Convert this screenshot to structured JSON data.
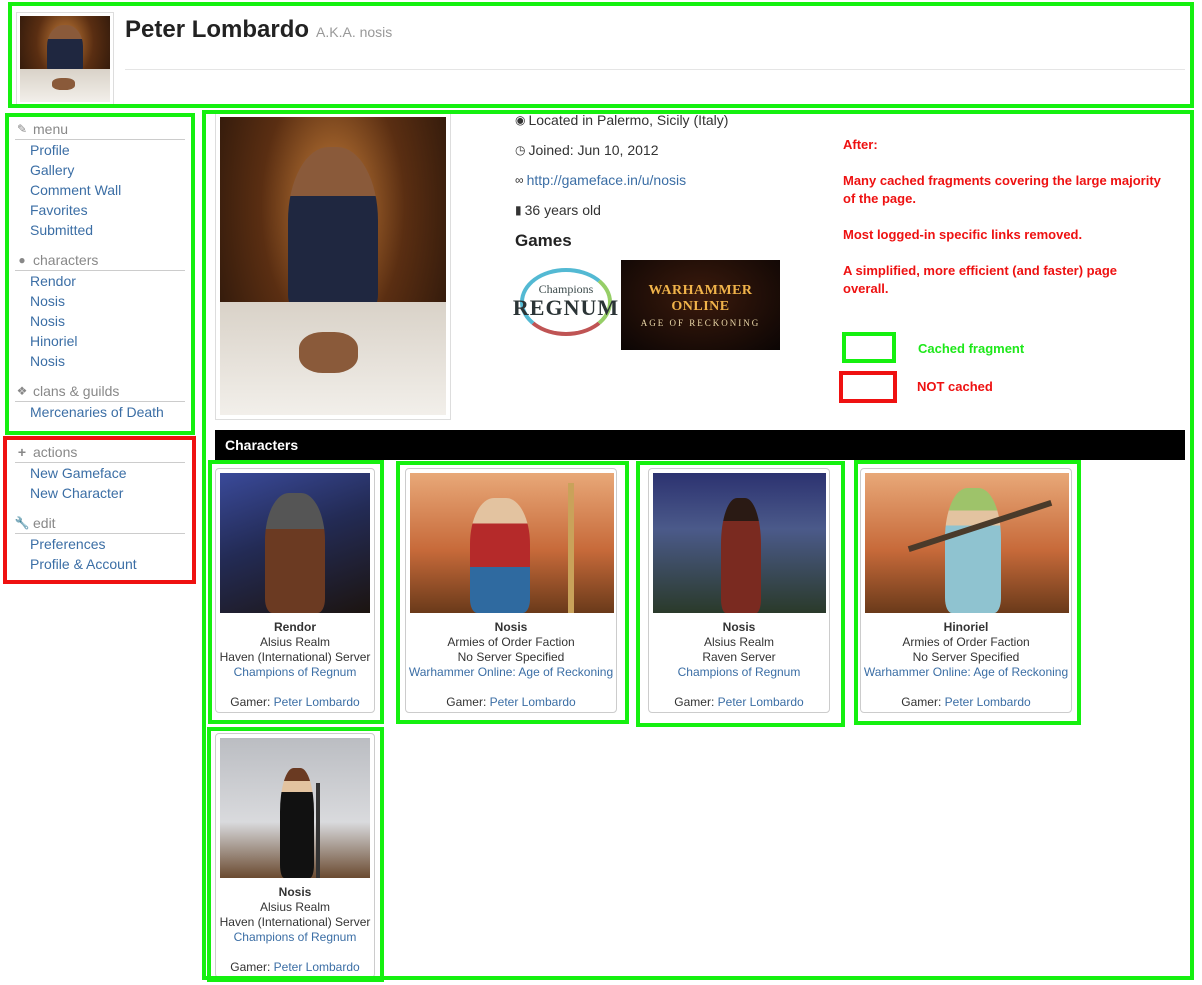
{
  "header": {
    "name": "Peter Lombardo",
    "aka": "A.K.A. nosis"
  },
  "sidebar": {
    "menu": {
      "heading": "menu",
      "items": [
        "Profile",
        "Gallery",
        "Comment Wall",
        "Favorites",
        "Submitted"
      ]
    },
    "characters": {
      "heading": "characters",
      "items": [
        "Rendor",
        "Nosis",
        "Nosis",
        "Hinoriel",
        "Nosis"
      ]
    },
    "clans": {
      "heading": "clans & guilds",
      "items": [
        "Mercenaries of Death"
      ]
    },
    "actions": {
      "heading": "actions",
      "items": [
        "New Gameface",
        "New Character"
      ]
    },
    "edit": {
      "heading": "edit",
      "items": [
        "Preferences",
        "Profile & Account"
      ]
    }
  },
  "profile": {
    "location": "Located in Palermo, Sicily (Italy)",
    "joined": "Joined: Jun 10, 2012",
    "url": "http://gameface.in/u/nosis",
    "age": "36 years old",
    "games_title": "Games",
    "games": [
      {
        "name_top": "Champions",
        "name_bottom": "REGNUM",
        "icon": "champions-of-regnum-logo"
      },
      {
        "name_top": "WARHAMMER ONLINE",
        "name_bottom": "AGE OF RECKONING",
        "icon": "warhammer-online-logo"
      }
    ]
  },
  "annotations": {
    "after": "After:",
    "line1": "Many cached fragments covering the large majority of the page.",
    "line2": "Most logged-in specific links removed.",
    "line3": "A simplified, more efficient (and faster) page overall.",
    "legend_cached": "Cached fragment",
    "legend_not_cached": "NOT cached",
    "colors": {
      "cached": "#15f00f",
      "not_cached": "#ef1111"
    }
  },
  "characters_section": {
    "title": "Characters",
    "gamer_label": "Gamer:",
    "cards": [
      {
        "name": "Rendor",
        "faction": "Alsius Realm",
        "server": "Haven (International) Server",
        "game": "Champions of Regnum",
        "gamer": "Peter Lombardo"
      },
      {
        "name": "Nosis",
        "faction": "Armies of Order Faction",
        "server": "No Server Specified",
        "game": "Warhammer Online: Age of Reckoning",
        "gamer": "Peter Lombardo"
      },
      {
        "name": "Nosis",
        "faction": "Alsius Realm",
        "server": "Raven Server",
        "game": "Champions of Regnum",
        "gamer": "Peter Lombardo"
      },
      {
        "name": "Hinoriel",
        "faction": "Armies of Order Faction",
        "server": "No Server Specified",
        "game": "Warhammer Online: Age of Reckoning",
        "gamer": "Peter Lombardo"
      },
      {
        "name": "Nosis",
        "faction": "Alsius Realm",
        "server": "Haven (International) Server",
        "game": "Champions of Regnum",
        "gamer": "Peter Lombardo"
      }
    ]
  }
}
